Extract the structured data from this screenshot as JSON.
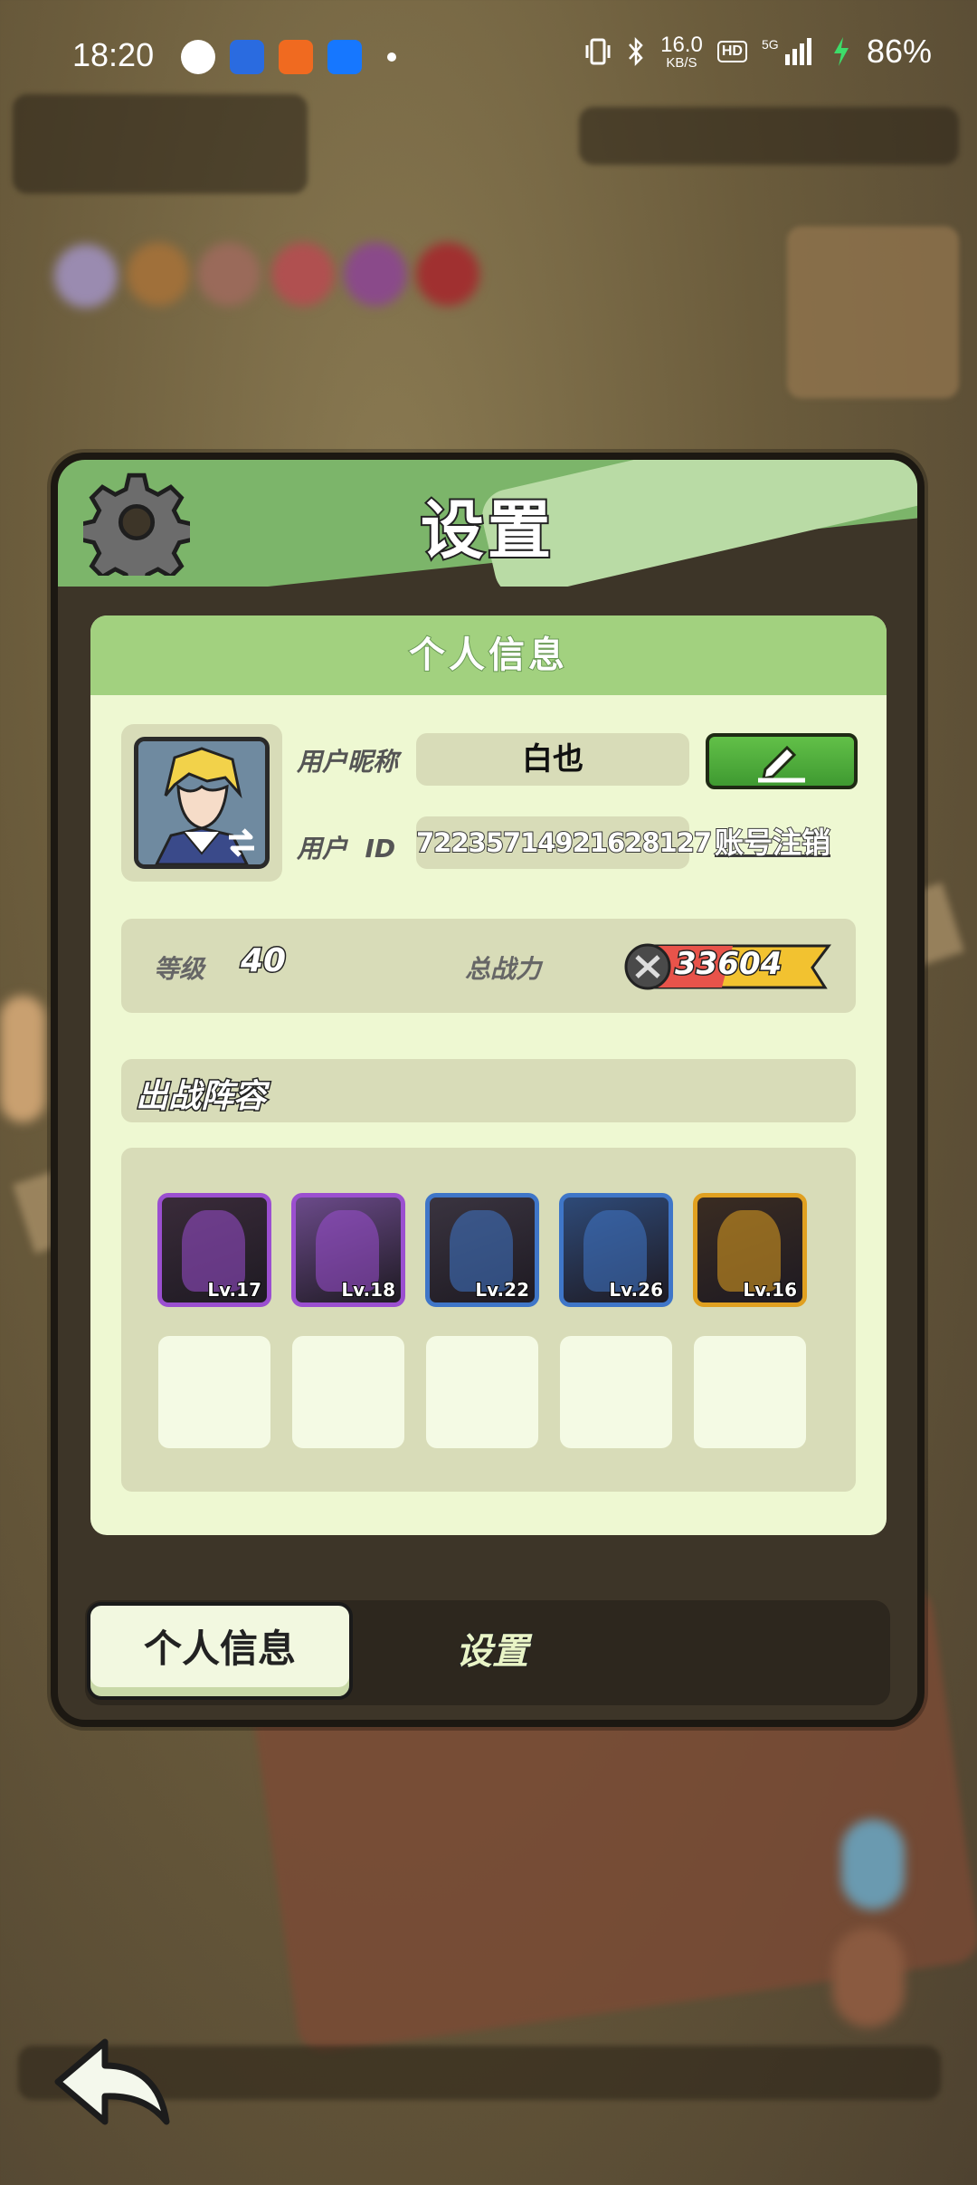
{
  "status_bar": {
    "time": "18:20",
    "net_speed_value": "16.0",
    "net_speed_unit": "KB/S",
    "hd_badge": "HD",
    "network": "5G",
    "battery": "86%",
    "notification_icons": [
      "qq-icon",
      "baidu-icon",
      "taobao-icon",
      "alipay-icon"
    ]
  },
  "dialog": {
    "title": "设置",
    "section_title": "个人信息",
    "profile": {
      "nickname_label": "用户昵称",
      "nickname": "白也",
      "id_label": "用户  ID",
      "user_id": "72235714921628127",
      "cancel_account": "账号注销"
    },
    "stats": {
      "level_label": "等级",
      "level": "40",
      "power_label": "总战力",
      "power": "33604"
    },
    "lineup": {
      "title": "出战阵容",
      "heroes": [
        {
          "level": "Lv.17",
          "frame": "#9b4fd0",
          "bg": "#3a2b3a",
          "name": "hero-goat-warrior"
        },
        {
          "level": "Lv.18",
          "frame": "#9b4fd0",
          "bg": "#6b4a8a",
          "name": "hero-armored-knight"
        },
        {
          "level": "Lv.22",
          "frame": "#3f76c8",
          "bg": "#3a3440",
          "name": "hero-beast"
        },
        {
          "level": "Lv.26",
          "frame": "#3f76c8",
          "bg": "#2e4a78",
          "name": "hero-blonde-swordsman"
        },
        {
          "level": "Lv.16",
          "frame": "#e0a020",
          "bg": "#3a2c22",
          "name": "hero-red-hair-girl"
        }
      ],
      "empty_slots": 5
    },
    "tabs": {
      "active": "个人信息",
      "inactive": "设置"
    }
  },
  "colors": {
    "header_green": "#7cb56a",
    "card_bg": "#eef8d2",
    "edit_button_green": "#4caf3a",
    "dialog_frame": "#3d3528"
  }
}
